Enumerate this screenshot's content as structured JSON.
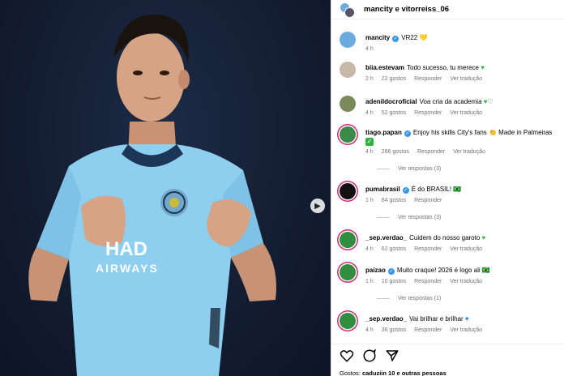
{
  "header": {
    "title": "mancity e vitorreiss_06"
  },
  "caption": {
    "user": "mancity",
    "text": "VR22 💛",
    "time": "4 h"
  },
  "comments": [
    {
      "user": "biia.estevam",
      "verified": false,
      "text": "Todo sucesso, tu merece",
      "suffix": "💚",
      "time": "2 h",
      "likes": "22 gostos",
      "reply": "Responder",
      "translate": "Ver tradução",
      "avatar_color": "#c8b8a8"
    },
    {
      "user": "adenildocroficial",
      "verified": false,
      "text": "Voa cria da academia",
      "suffix": "💚🤍",
      "time": "4 h",
      "likes": "52 gostos",
      "reply": "Responder",
      "translate": "Ver tradução",
      "avatar_color": "#7a8a5a"
    },
    {
      "user": "tiago.papan",
      "verified": true,
      "text": "Enjoy his skills City's fans 👏 Made in Palmeiras",
      "suffix": "✓",
      "time": "4 h",
      "likes": "266 gostos",
      "reply": "Responder",
      "translate": "Ver tradução",
      "avatar_color": "#3a8a4a",
      "view_replies": "Ver respostas (3)"
    },
    {
      "user": "pumabrasil",
      "verified": true,
      "text": "É do BRASIL! 🇧🇷",
      "suffix": "",
      "time": "1 h",
      "likes": "84 gostos",
      "reply": "Responder",
      "translate": "",
      "avatar_color": "#111111",
      "view_replies": "Ver respostas (3)"
    },
    {
      "user": "_sep.verdao_",
      "verified": false,
      "text": "Cuidem do nosso garoto",
      "suffix": "💚",
      "time": "4 h",
      "likes": "62 gostos",
      "reply": "Responder",
      "translate": "Ver tradução",
      "avatar_color": "#2f8f3f"
    },
    {
      "user": "paizao",
      "verified": true,
      "text": "Muito craque! 2026 é logo ali 🇧🇷",
      "suffix": "",
      "time": "1 h",
      "likes": "10 gostos",
      "reply": "Responder",
      "translate": "Ver tradução",
      "avatar_color": "#2f8f3f",
      "view_replies": "Ver respostas (1)"
    },
    {
      "user": "_sep.verdao_",
      "verified": false,
      "text": "Vai brilhar e brilhar",
      "suffix": "💙",
      "time": "4 h",
      "likes": "36 gostos",
      "reply": "Responder",
      "translate": "Ver tradução",
      "avatar_color": "#2f8f3f"
    }
  ],
  "likes_line": {
    "prefix": "Gostos:",
    "user": "caduziin",
    "rest": "10 e outras pessoas"
  },
  "photo": {
    "jersey_text_1": "HAD",
    "jersey_text_2": "AIRWAYS"
  },
  "colors": {
    "jersey": "#8ecff0",
    "background": "#141e33",
    "verified": "#3897f0"
  }
}
